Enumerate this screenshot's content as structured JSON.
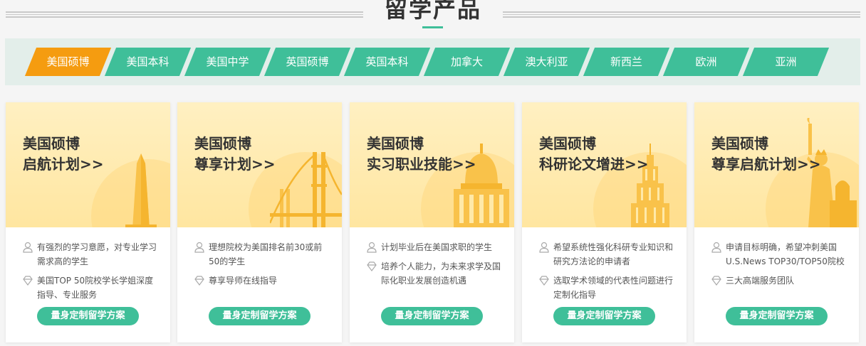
{
  "section_title": "留学产品",
  "tabs": [
    {
      "label": "美国硕博",
      "active": true
    },
    {
      "label": "美国本科",
      "active": false
    },
    {
      "label": "美国中学",
      "active": false
    },
    {
      "label": "英国硕博",
      "active": false
    },
    {
      "label": "英国本科",
      "active": false
    },
    {
      "label": "加拿大",
      "active": false
    },
    {
      "label": "澳大利亚",
      "active": false
    },
    {
      "label": "新西兰",
      "active": false
    },
    {
      "label": "欧洲",
      "active": false
    },
    {
      "label": "亚洲",
      "active": false
    }
  ],
  "cards": [
    {
      "title_line1": "美国硕博",
      "title_line2": "启航计划>>",
      "illustration": "monument-tower",
      "audience": "有强烈的学习意愿，对专业学习需求高的学生",
      "service": "美国TOP 50院校学长学姐深度指导、专业服务",
      "button": "量身定制留学方案"
    },
    {
      "title_line1": "美国硕博",
      "title_line2": "尊享计划>>",
      "illustration": "golden-gate-bridge",
      "audience": "理想院校为美国排名前30或前50的学生",
      "service": "尊享导师在线指导",
      "button": "量身定制留学方案"
    },
    {
      "title_line1": "美国硕博",
      "title_line2": "实习职业技能>>",
      "illustration": "capitol-dome",
      "audience": "计划毕业后在美国求职的学生",
      "service": "培养个人能力，为未来求学及国际化职业发展创造机遇",
      "button": "量身定制留学方案"
    },
    {
      "title_line1": "美国硕博",
      "title_line2": "科研论文增进>>",
      "illustration": "empire-state-building",
      "audience": "希望系统性强化科研专业知识和研究方法论的申请者",
      "service": "选取学术领域的代表性问题进行定制化指导",
      "button": "量身定制留学方案"
    },
    {
      "title_line1": "美国硕博",
      "title_line2": "尊享启航计划>>",
      "illustration": "statue-of-liberty",
      "audience": "申请目标明确，希望冲刺美国U.S.News TOP30/TOP50院校",
      "service": "三大高端服务团队",
      "button": "量身定制留学方案"
    }
  ],
  "icons": {
    "audience": "user-icon",
    "service": "diamond-icon"
  },
  "colors": {
    "accent": "#3fbf99",
    "active_tab": "#f59c10",
    "card_top": "#ffe9a8",
    "illustration": "#f9c24a"
  }
}
